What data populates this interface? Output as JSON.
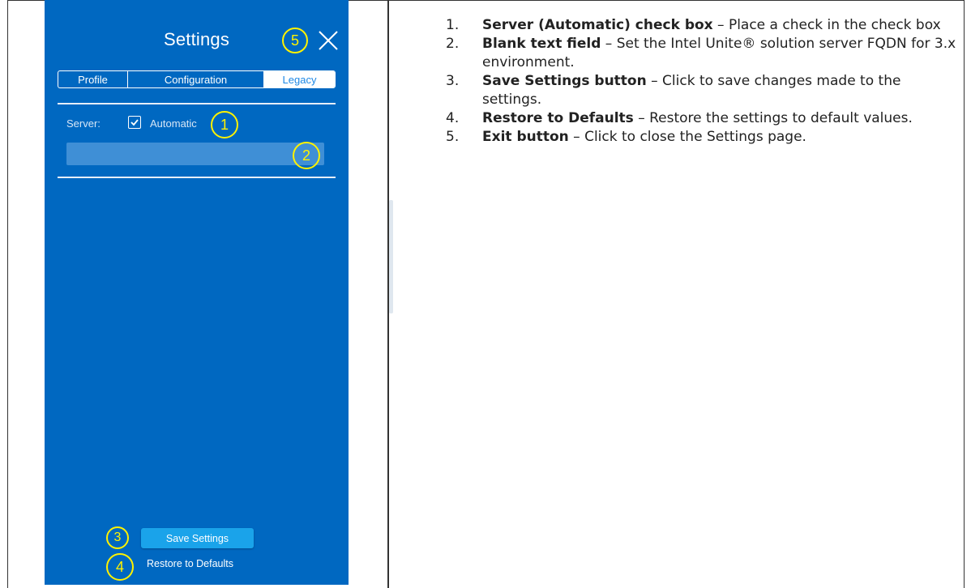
{
  "settings_panel": {
    "title": "Settings",
    "tabs": [
      {
        "label": "Profile",
        "active": false
      },
      {
        "label": "Configuration",
        "active": false
      },
      {
        "label": "Legacy",
        "active": true
      }
    ],
    "server_label": "Server:",
    "automatic_label": "Automatic",
    "automatic_checked": true,
    "server_field_value": "",
    "save_button": "Save Settings",
    "restore_link": "Restore to Defaults",
    "close_icon": "close-icon",
    "colors": {
      "panel_bg": "#0068c1",
      "accent": "#1aa3ea",
      "callout": "#fff200"
    }
  },
  "callouts": [
    "1",
    "2",
    "3",
    "4",
    "5"
  ],
  "instructions": [
    {
      "number": "1.",
      "title": "Server (Automatic) check box",
      "text": " – Place a check in the check box"
    },
    {
      "number": "2.",
      "title": "Blank text field",
      "text": " – Set the Intel Unite® solution server FQDN for 3.x environment."
    },
    {
      "number": "3.",
      "title": "Save Settings button",
      "text": " – Click to save changes made to the settings."
    },
    {
      "number": "4.",
      "title": "Restore to Defaults",
      "text": " – Restore the settings to default values."
    },
    {
      "number": "5.",
      "title": "Exit button",
      "text": " – Click to close the Settings page."
    }
  ]
}
